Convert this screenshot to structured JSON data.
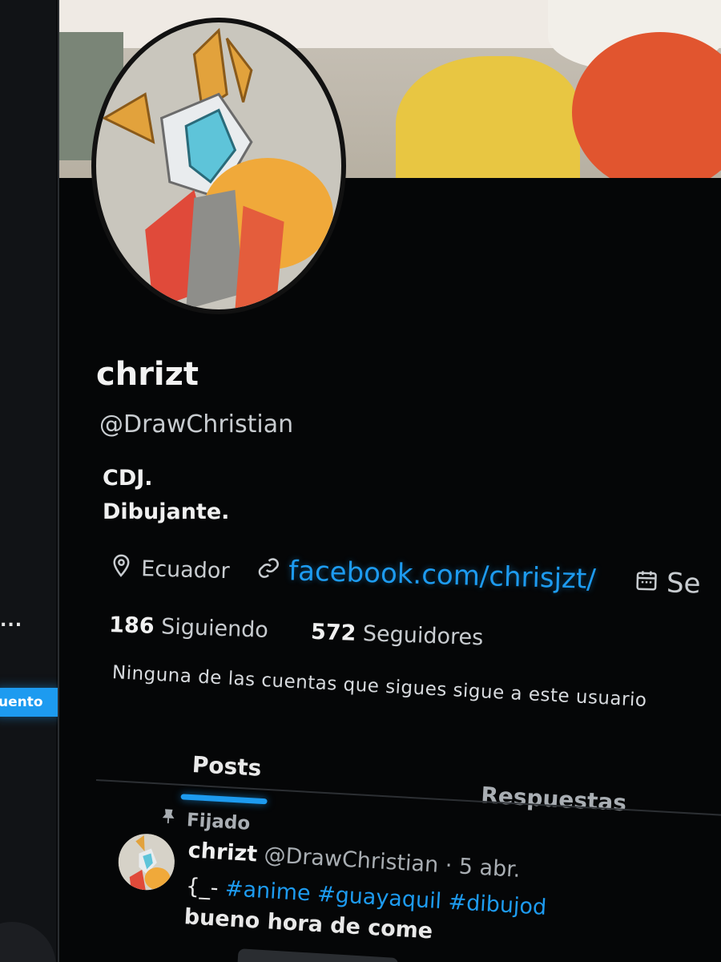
{
  "left_column": {
    "truncated_text": "...",
    "button_label": "uento"
  },
  "profile": {
    "display_name": "chrizt",
    "handle": "@DrawChristian",
    "bio_line1": "CDJ.",
    "bio_line2": "Dibujante.",
    "location": "Ecuador",
    "website": "facebook.com/chrisjzt/",
    "joined_truncated": "Se",
    "following_count": "186",
    "following_label": "Siguiendo",
    "followers_count": "572",
    "followers_label": "Seguidores",
    "followed_note": "Ninguna de las cuentas que sigues sigue a este usuario"
  },
  "tabs": [
    {
      "label": "Posts",
      "active": true
    },
    {
      "label": "Respuestas",
      "active": false
    }
  ],
  "pinned_post": {
    "pinned_label": "Fijado",
    "author_name": "chrizt",
    "author_handle": "@DrawChristian",
    "separator": "·",
    "date": "5 abr.",
    "text_prefix": "{_-",
    "hashtags": "#anime #guayaquil #dibujod",
    "text_line2": "bueno hora de come"
  },
  "colors": {
    "accent": "#1d9bf0",
    "background": "#050607",
    "text_primary": "#f0f0f0",
    "text_secondary": "#a9aeb3"
  },
  "icons": {
    "location": "location-pin-icon",
    "link": "link-icon",
    "calendar": "calendar-icon",
    "pin": "pin-icon"
  }
}
